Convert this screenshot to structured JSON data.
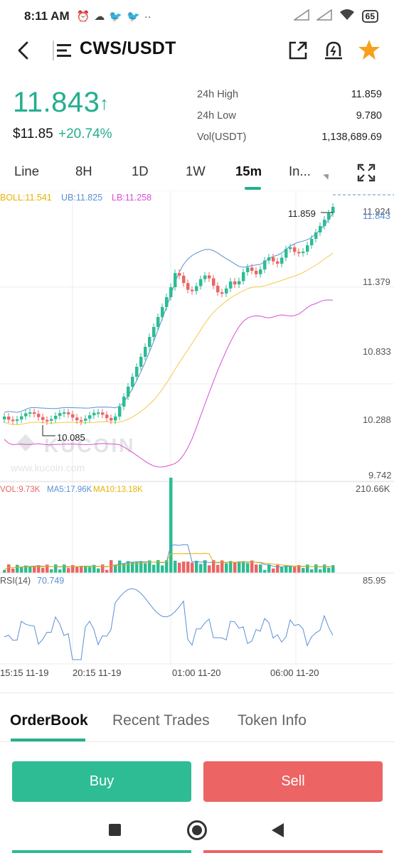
{
  "status_bar": {
    "time": "8:11 AM",
    "left_icons": [
      "alarm-icon",
      "cloud-icon",
      "twitter-icon",
      "twitter-icon",
      "more-icon"
    ],
    "right_icons": [
      "signal-icon",
      "signal-icon",
      "wifi-icon"
    ],
    "battery": "65"
  },
  "header": {
    "pair": "CWS/USDT"
  },
  "ticker": {
    "last_price": "11.843",
    "arrow": "↑",
    "usd_price": "$11.85",
    "change_pct": "+20.74%",
    "stats": [
      {
        "label": "24h High",
        "value": "11.859"
      },
      {
        "label": "24h Low",
        "value": "9.780"
      },
      {
        "label": "Vol(USDT)",
        "value": "1,138,689.69"
      }
    ]
  },
  "timeframes": {
    "tabs": [
      "Line",
      "8H",
      "1D",
      "1W",
      "15m",
      "In..."
    ],
    "active": "15m"
  },
  "chart": {
    "boll_label": "BOLL:11.541",
    "ub_label": "UB:11.825",
    "lb_label": "LB:11.258",
    "price_axis": [
      "11.924",
      "11.843",
      "11.379",
      "10.833",
      "10.288",
      "9.742"
    ],
    "high_marker": "11.859",
    "low_marker": "10.085",
    "watermark": "KUCOIN",
    "watermark_url": "www.kucoin.com",
    "vol_label": "VOL:9.73K",
    "ma5_label": "MA5:17.96K",
    "ma10_label": "MA10:13.18K",
    "vol_axis": "210.66K",
    "rsi_label": "RSI(14)",
    "rsi_value": "70.749",
    "rsi_axis": "85.95",
    "time_axis": [
      "15:15 11-19",
      "20:15 11-19",
      "01:00 11-20",
      "06:00 11-20"
    ],
    "colors": {
      "up": "#2dbc93",
      "down": "#ec6464",
      "boll": "#f2c94c",
      "ub": "#5b8fd6",
      "lb": "#d94fd4",
      "rsi": "#5b8fd6"
    }
  },
  "bottom_tabs": {
    "tabs": [
      "OrderBook",
      "Recent Trades",
      "Token Info"
    ],
    "active": "OrderBook"
  },
  "actions": {
    "buy": "Buy",
    "sell": "Sell"
  }
}
